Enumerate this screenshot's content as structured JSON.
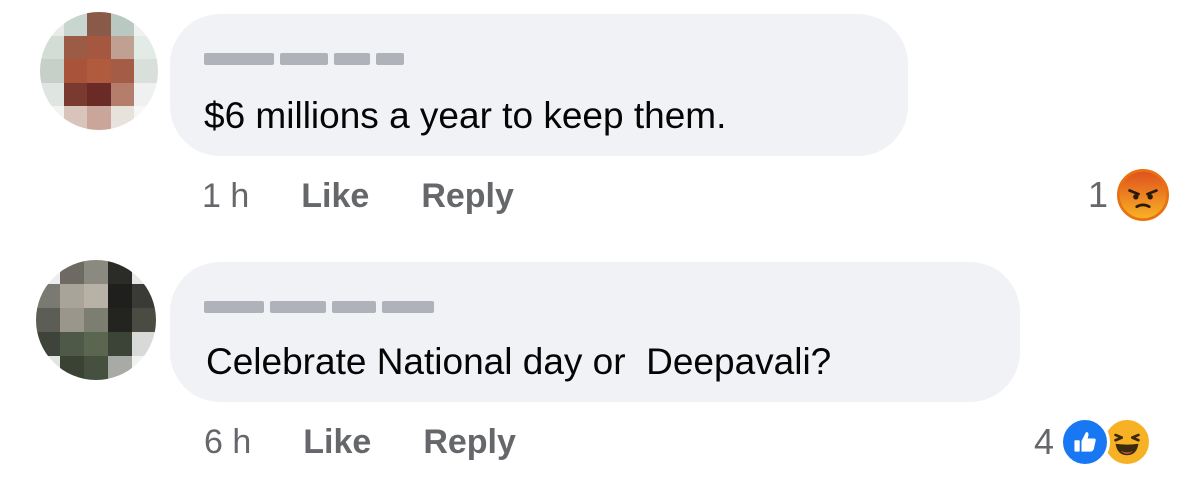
{
  "comments": [
    {
      "text": "$6 millions a year to keep them.",
      "time": "1 h",
      "like_label": "Like",
      "reply_label": "Reply",
      "reaction_count": "1",
      "reactions": [
        "angry-reaction-icon"
      ]
    },
    {
      "text": "Celebrate National day or  Deepavali?",
      "time": "6 h",
      "like_label": "Like",
      "reply_label": "Reply",
      "reaction_count": "4",
      "reactions": [
        "like-reaction-icon",
        "haha-reaction-icon"
      ]
    }
  ],
  "colors": {
    "bubble": "#f0f2f5",
    "secondary_text": "#65676b",
    "like_blue": "#1877f2",
    "reaction_yellow": "#f7b125",
    "angry_orange": "#e9710f"
  }
}
